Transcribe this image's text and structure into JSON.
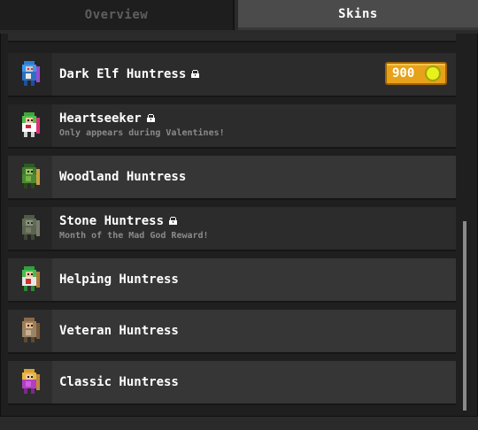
{
  "tabs": {
    "overview": "Overview",
    "skins": "Skins",
    "active": "skins"
  },
  "skins": [
    {
      "name": "Dark Elf Huntress",
      "locked": true,
      "subtitle": "",
      "price": "900",
      "icon": "dark-elf-huntress-sprite"
    },
    {
      "name": "Heartseeker",
      "locked": true,
      "subtitle": "Only appears during Valentines!",
      "icon": "heartseeker-sprite"
    },
    {
      "name": "Woodland Huntress",
      "locked": false,
      "subtitle": "",
      "icon": "woodland-huntress-sprite"
    },
    {
      "name": "Stone Huntress",
      "locked": true,
      "subtitle": "Month of the Mad God Reward!",
      "icon": "stone-huntress-sprite"
    },
    {
      "name": "Helping Huntress",
      "locked": false,
      "subtitle": "",
      "icon": "helping-huntress-sprite"
    },
    {
      "name": "Veteran Huntress",
      "locked": false,
      "subtitle": "",
      "icon": "veteran-huntress-sprite"
    },
    {
      "name": "Classic Huntress",
      "locked": false,
      "subtitle": "",
      "icon": "classic-huntress-sprite"
    }
  ],
  "colors": {
    "coin": "#e8f21a",
    "price_button": "#e8a21a",
    "panel_bg": "#1f1f1f",
    "row_bg": "#363636"
  }
}
